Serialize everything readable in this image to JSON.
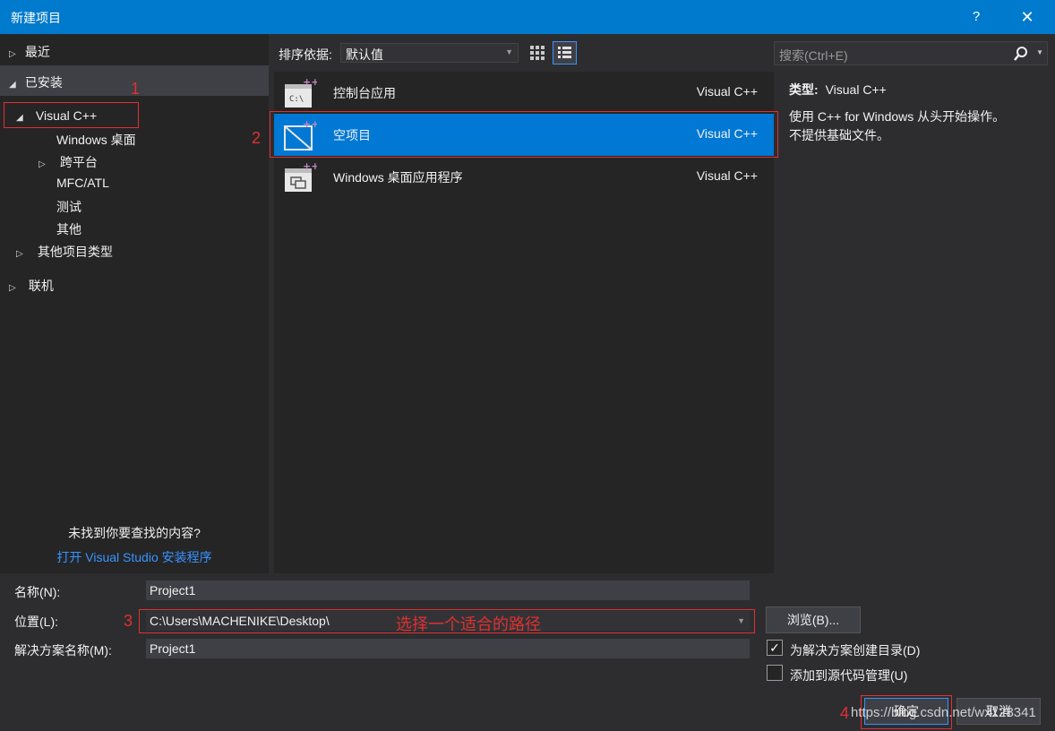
{
  "window": {
    "title": "新建项目",
    "help": "?",
    "close": "✕"
  },
  "left": {
    "recent": "最近",
    "installed": "已安装",
    "visual_cpp": "Visual C++",
    "children": [
      "Windows 桌面",
      "跨平台",
      "MFC/ATL",
      "测试",
      "其他"
    ],
    "other_types": "其他项目类型",
    "online": "联机",
    "not_found": "未找到你要查找的内容?",
    "open_installer": "打开 Visual Studio 安装程序"
  },
  "sort": {
    "label": "排序依据:",
    "value": "默认值"
  },
  "templates": [
    {
      "name": "控制台应用",
      "lang": "Visual C++",
      "icon": "console-app-icon",
      "selected": false
    },
    {
      "name": "空项目",
      "lang": "Visual C++",
      "icon": "empty-project-icon",
      "selected": true
    },
    {
      "name": "Windows 桌面应用程序",
      "lang": "Visual C++",
      "icon": "windows-desktop-app-icon",
      "selected": false
    }
  ],
  "search": {
    "placeholder": "搜索(Ctrl+E)"
  },
  "details": {
    "type_label": "类型:",
    "type_value": "Visual C++",
    "desc_line1": "使用 C++ for Windows 从头开始操作。",
    "desc_line2": "不提供基础文件。"
  },
  "form": {
    "name_label": "名称(N):",
    "name_value": "Project1",
    "location_label": "位置(L):",
    "location_value": "C:\\Users\\MACHENIKE\\Desktop\\",
    "solution_label": "解决方案名称(M):",
    "solution_value": "Project1",
    "browse": "浏览(B)...",
    "create_dir": "为解决方案创建目录(D)",
    "create_dir_checked": true,
    "add_scm": "添加到源代码管理(U)",
    "add_scm_checked": false,
    "ok": "确定",
    "cancel": "取消"
  },
  "annotations": {
    "n1": "1",
    "n2": "2",
    "n3": "3",
    "n4": "4",
    "hint": "选择一个适合的路径",
    "watermark": "https://blog.csdn.net/wx128341"
  },
  "colors": {
    "accent": "#007acc",
    "selected": "#0078d4",
    "annotation": "#e03030",
    "link": "#3794ff"
  }
}
